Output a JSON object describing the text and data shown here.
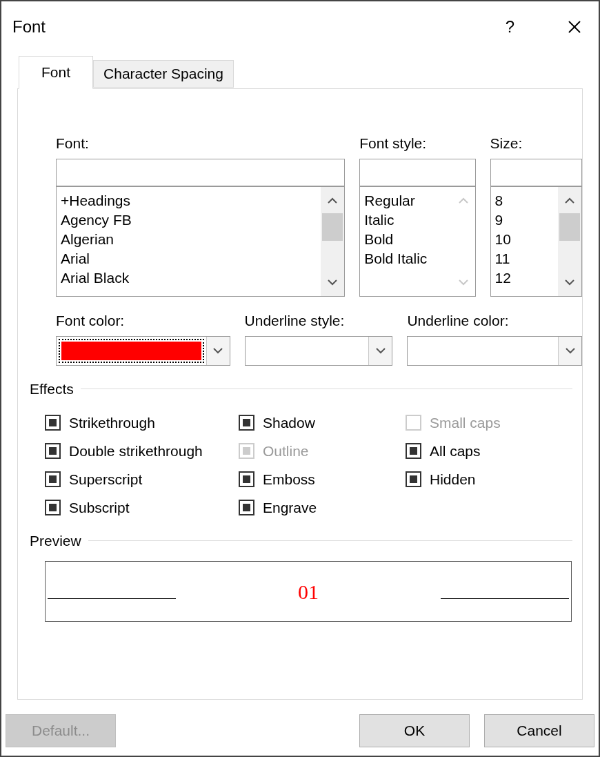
{
  "window": {
    "title": "Font",
    "help": "?"
  },
  "tabs": [
    {
      "label": "Font",
      "selected": true
    },
    {
      "label": "Character Spacing",
      "selected": false
    }
  ],
  "lists": [
    {
      "label": "Font:",
      "items": [
        "+Headings",
        "Agency FB",
        "Algerian",
        "Arial",
        "Arial Black"
      ],
      "scroll_disabled": false
    },
    {
      "label": "Font style:",
      "items": [
        "Regular",
        "Italic",
        "Bold",
        "Bold Italic"
      ],
      "scroll_disabled": true
    },
    {
      "label": "Size:",
      "items": [
        "8",
        "9",
        "10",
        "11",
        "12"
      ],
      "scroll_disabled": false
    }
  ],
  "dropdowns": [
    {
      "label": "Font color:",
      "color": "#ff0000",
      "focused": true
    },
    {
      "label": "Underline style:",
      "focused": false
    },
    {
      "label": "Underline color:",
      "focused": false
    }
  ],
  "effects": {
    "label": "Effects",
    "columns": [
      [
        {
          "label": "Strikethrough",
          "indeterminate": true,
          "disabled": false
        },
        {
          "label": "Double strikethrough",
          "indeterminate": true,
          "disabled": false
        },
        {
          "label": "Superscript",
          "indeterminate": true,
          "disabled": false
        },
        {
          "label": "Subscript",
          "indeterminate": true,
          "disabled": false
        }
      ],
      [
        {
          "label": "Shadow",
          "indeterminate": true,
          "disabled": false
        },
        {
          "label": "Outline",
          "indeterminate": true,
          "disabled": true
        },
        {
          "label": "Emboss",
          "indeterminate": true,
          "disabled": false
        },
        {
          "label": "Engrave",
          "indeterminate": true,
          "disabled": false
        }
      ],
      [
        {
          "label": "Small caps",
          "indeterminate": false,
          "disabled": true
        },
        {
          "label": "All caps",
          "indeterminate": true,
          "disabled": false
        },
        {
          "label": "Hidden",
          "indeterminate": true,
          "disabled": false
        }
      ]
    ]
  },
  "preview": {
    "label": "Preview",
    "text": "01",
    "color": "#ff0000"
  },
  "buttons": [
    {
      "label": "Default...",
      "disabled": true
    },
    {
      "label": "OK",
      "disabled": false
    },
    {
      "label": "Cancel",
      "disabled": false
    }
  ]
}
